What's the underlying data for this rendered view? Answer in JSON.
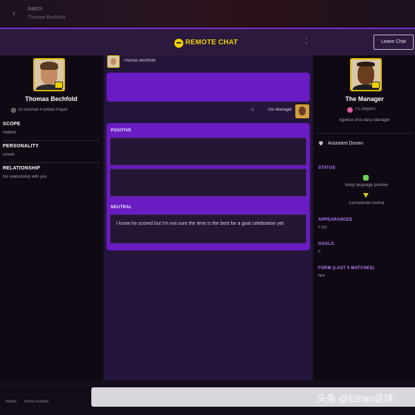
{
  "topbar": {
    "crumb_primary": "INBOX",
    "crumb_secondary": "Thomas Bechfold"
  },
  "header": {
    "title": "REMOTE CHAT",
    "leave_label": "Leave Chat"
  },
  "left_profile": {
    "name": "Thomas Bechfold",
    "subtitle": "23 German Football Player",
    "scope_label": "SCOPE",
    "scope_value": "Rattled",
    "personality_label": "PERSONALITY",
    "personality_value": "Driven",
    "relationship_label": "RELATIONSHIP",
    "relationship_value": "No relationship with you"
  },
  "chat": {
    "sender_name": "Thomas Bechfold",
    "reply_name": "The Manager",
    "positive_label": "POSITIVE",
    "neutral_label": "NEUTRAL",
    "neutral_option_text": "I know he scored but I'm not sure the time is the best for a goal celebration yet"
  },
  "right_profile": {
    "name": "The Manager",
    "club": "FC Bayern",
    "subtitle": "Ageless first-class Manager",
    "assistant_name": "Assistant Dorian",
    "status_label": "STATUS",
    "status_positive": "Body language positive",
    "status_neutral": "Considered neutral",
    "appearances_label": "APPEARANCES",
    "appearances_value": "0 (0)",
    "goals_label": "GOALS",
    "goals_value": "0",
    "form_label": "FORM (LAST 5 MATCHES)",
    "form_value": "N/A"
  },
  "bottom": {
    "left_text_a": "Home",
    "left_text_b": "Press Events"
  },
  "watermark": "头条 @Ethan说球",
  "icons": {
    "back": "back-arrow-icon",
    "chat": "chat-bubble-icon",
    "shield": "shield-icon",
    "club": "club-crest-icon",
    "mood_positive": "mood-positive-icon",
    "mood_neutral": "mood-neutral-icon"
  },
  "colors": {
    "accent_purple": "#6a1bc2",
    "accent_yellow": "#f0d100",
    "label_purple": "#b780ff",
    "panel_dark": "#0f0913"
  }
}
